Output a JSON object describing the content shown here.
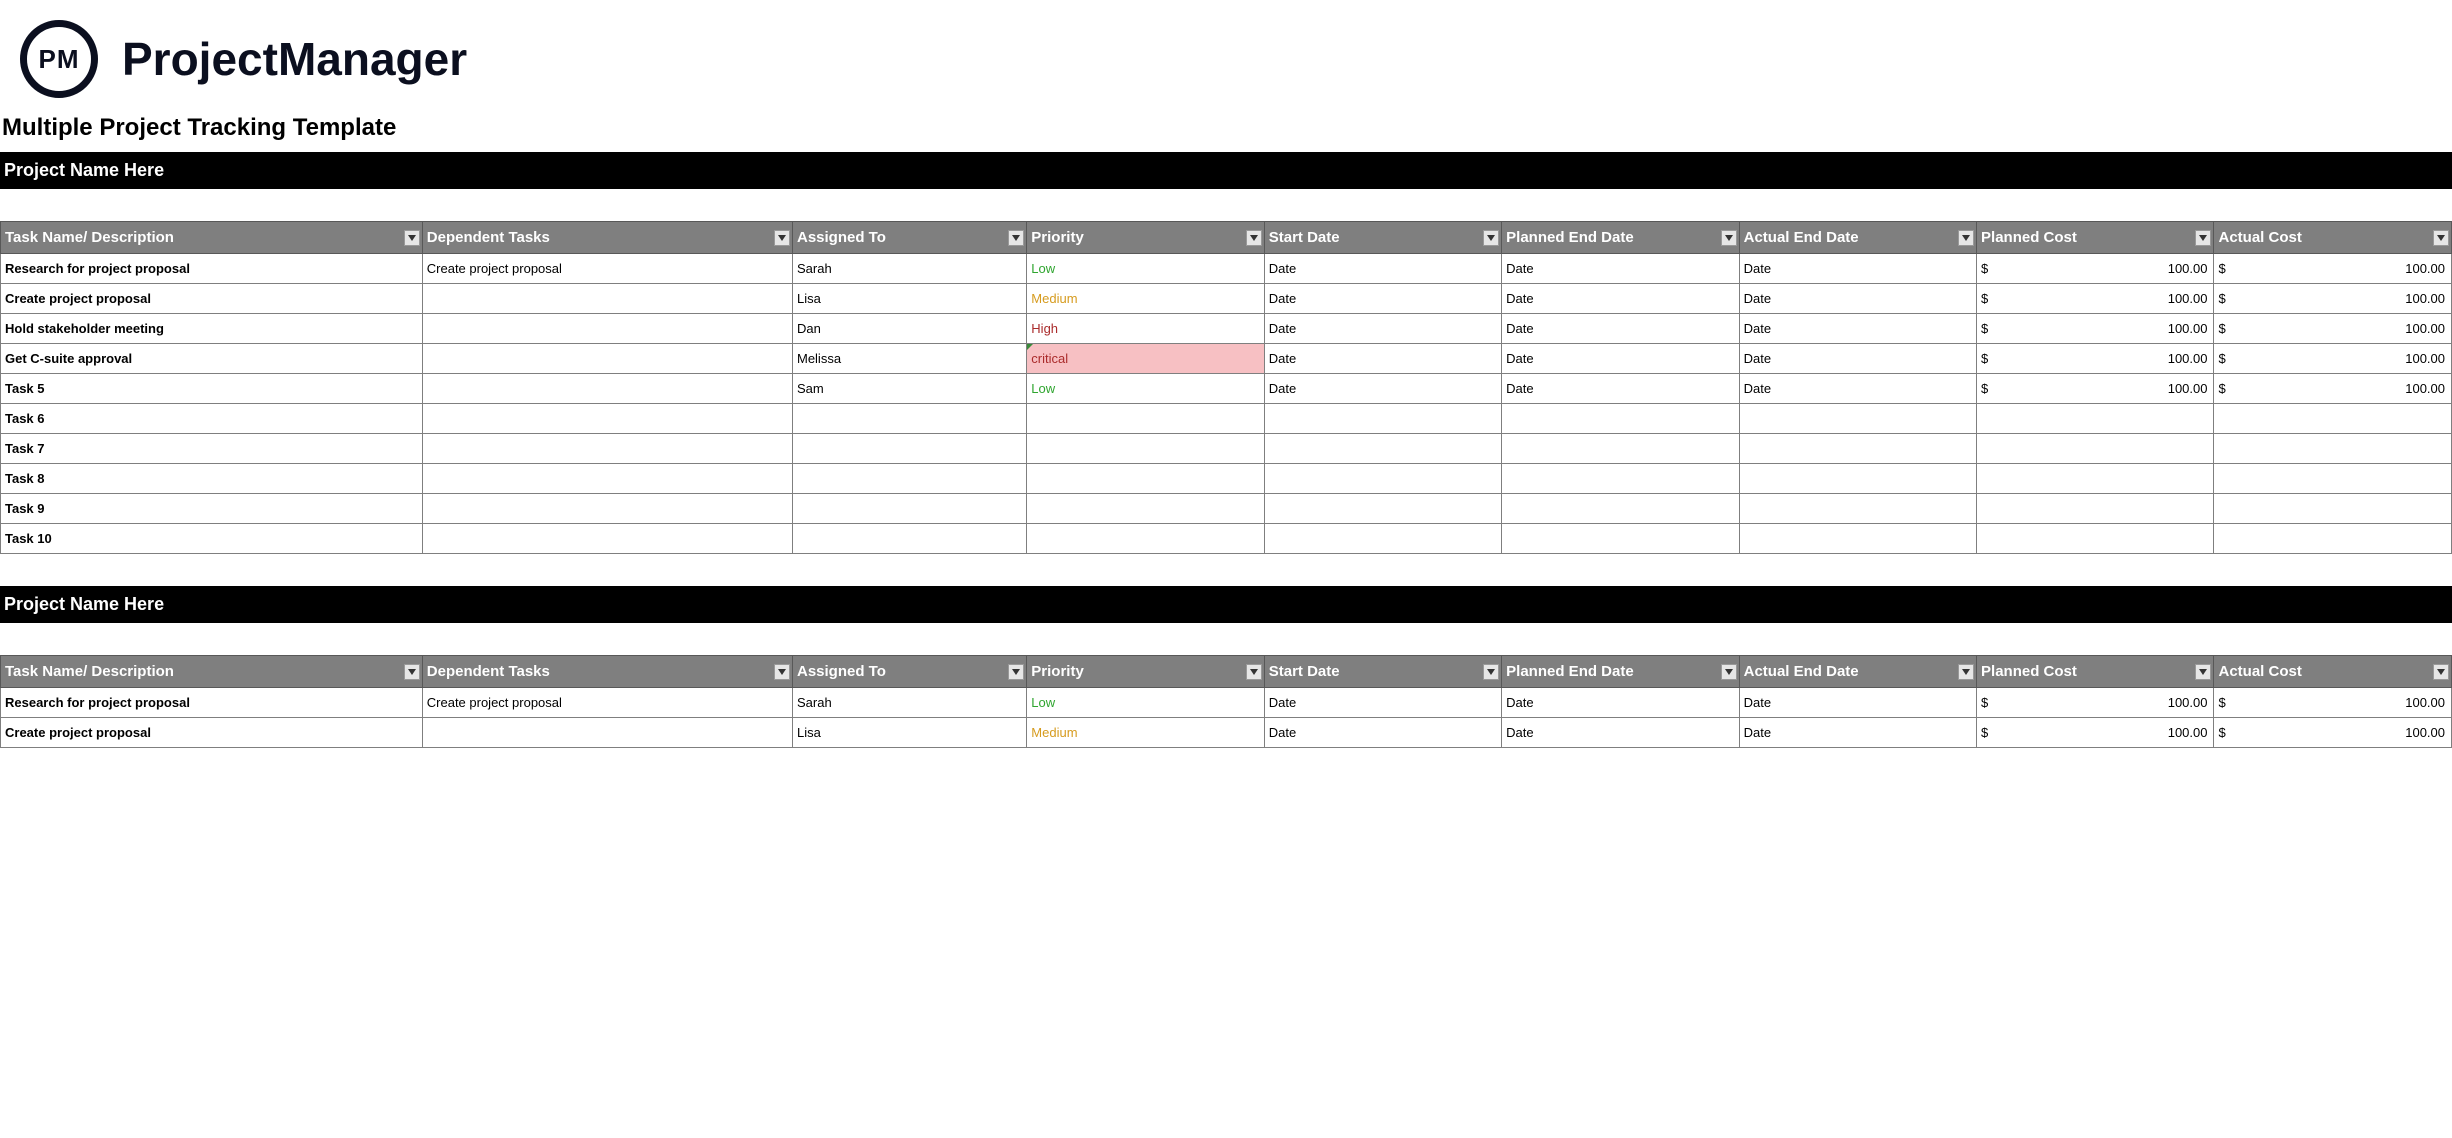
{
  "brand": {
    "logo_initials": "PM",
    "name": "ProjectManager"
  },
  "page_title": "Multiple Project Tracking Template",
  "columns": {
    "task": "Task Name/ Description",
    "dependent": "Dependent Tasks",
    "assigned": "Assigned To",
    "priority": "Priority",
    "start": "Start Date",
    "planned_end": "Planned End Date",
    "actual_end": "Actual End Date",
    "planned_cost": "Planned Cost",
    "actual_cost": "Actual Cost"
  },
  "projects": [
    {
      "name": "Project Name Here",
      "rows": [
        {
          "task": "Research for project proposal",
          "dependent": "Create project proposal",
          "assigned": "Sarah",
          "priority": "Low",
          "priority_class": "low",
          "start": "Date",
          "planned_end": "Date",
          "actual_end": "Date",
          "planned_cost": "100.00",
          "actual_cost": "100.00"
        },
        {
          "task": "Create project proposal",
          "dependent": "",
          "assigned": "Lisa",
          "priority": "Medium",
          "priority_class": "medium",
          "start": "Date",
          "planned_end": "Date",
          "actual_end": "Date",
          "planned_cost": "100.00",
          "actual_cost": "100.00"
        },
        {
          "task": "Hold stakeholder meeting",
          "dependent": "",
          "assigned": "Dan",
          "priority": "High",
          "priority_class": "high",
          "start": "Date",
          "planned_end": "Date",
          "actual_end": "Date",
          "planned_cost": "100.00",
          "actual_cost": "100.00"
        },
        {
          "task": "Get C-suite approval",
          "dependent": "",
          "assigned": "Melissa",
          "priority": "critical",
          "priority_class": "critical",
          "start": "Date",
          "planned_end": "Date",
          "actual_end": "Date",
          "planned_cost": "100.00",
          "actual_cost": "100.00"
        },
        {
          "task": "Task 5",
          "dependent": "",
          "assigned": "Sam",
          "priority": "Low",
          "priority_class": "low",
          "start": "Date",
          "planned_end": "Date",
          "actual_end": "Date",
          "planned_cost": "100.00",
          "actual_cost": "100.00"
        },
        {
          "task": "Task 6",
          "dependent": "",
          "assigned": "",
          "priority": "",
          "priority_class": "",
          "start": "",
          "planned_end": "",
          "actual_end": "",
          "planned_cost": "",
          "actual_cost": ""
        },
        {
          "task": "Task 7",
          "dependent": "",
          "assigned": "",
          "priority": "",
          "priority_class": "",
          "start": "",
          "planned_end": "",
          "actual_end": "",
          "planned_cost": "",
          "actual_cost": ""
        },
        {
          "task": "Task 8",
          "dependent": "",
          "assigned": "",
          "priority": "",
          "priority_class": "",
          "start": "",
          "planned_end": "",
          "actual_end": "",
          "planned_cost": "",
          "actual_cost": ""
        },
        {
          "task": "Task 9",
          "dependent": "",
          "assigned": "",
          "priority": "",
          "priority_class": "",
          "start": "",
          "planned_end": "",
          "actual_end": "",
          "planned_cost": "",
          "actual_cost": ""
        },
        {
          "task": "Task 10",
          "dependent": "",
          "assigned": "",
          "priority": "",
          "priority_class": "",
          "start": "",
          "planned_end": "",
          "actual_end": "",
          "planned_cost": "",
          "actual_cost": ""
        }
      ]
    },
    {
      "name": "Project Name Here",
      "rows": [
        {
          "task": "Research for project proposal",
          "dependent": "Create project proposal",
          "assigned": "Sarah",
          "priority": "Low",
          "priority_class": "low",
          "start": "Date",
          "planned_end": "Date",
          "actual_end": "Date",
          "planned_cost": "100.00",
          "actual_cost": "100.00"
        },
        {
          "task": "Create project proposal",
          "dependent": "",
          "assigned": "Lisa",
          "priority": "Medium",
          "priority_class": "medium",
          "start": "Date",
          "planned_end": "Date",
          "actual_end": "Date",
          "planned_cost": "100.00",
          "actual_cost": "100.00"
        }
      ]
    }
  ],
  "currency_symbol": "$"
}
